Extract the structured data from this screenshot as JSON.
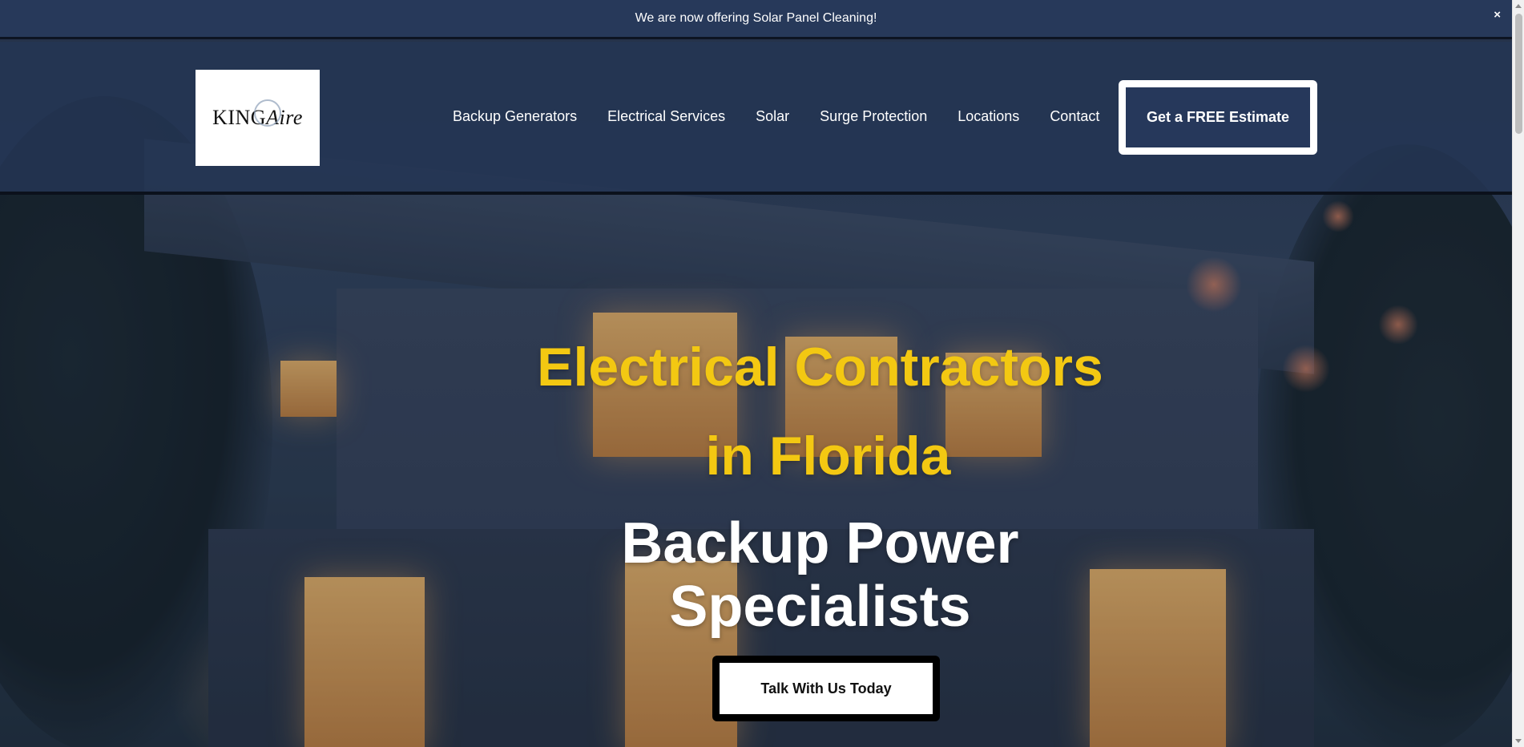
{
  "announcement": {
    "text": "We are now offering Solar Panel Cleaning!",
    "close": "×"
  },
  "header": {
    "logo": {
      "part1": "KING",
      "part2": "Aire"
    },
    "nav": [
      {
        "label": "Backup Generators"
      },
      {
        "label": "Electrical Services"
      },
      {
        "label": "Solar"
      },
      {
        "label": "Surge Protection"
      },
      {
        "label": "Locations"
      },
      {
        "label": "Contact"
      }
    ],
    "cta_label": "Get a FREE Estimate"
  },
  "hero": {
    "title_line1": "Electrical Contractors",
    "title_line2": "in Florida",
    "subtitle_line1": "Backup Power",
    "subtitle_line2": "Specialists",
    "button_label": "Talk With Us Today"
  },
  "colors": {
    "brand_navy": "#26385b",
    "accent_yellow": "#f3c812"
  }
}
